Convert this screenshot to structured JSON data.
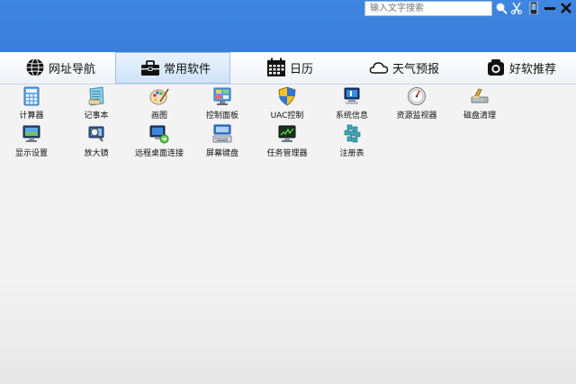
{
  "search": {
    "placeholder": "输入文字搜索"
  },
  "toolbar_icons": [
    "search-icon",
    "scissors-icon",
    "phone-icon",
    "minimize-icon",
    "close-icon"
  ],
  "tabs": [
    {
      "label": "网址导航",
      "icon": "globe-icon",
      "active": false
    },
    {
      "label": "常用软件",
      "icon": "toolbox-icon",
      "active": true
    },
    {
      "label": "日历",
      "icon": "calendar-icon",
      "active": false
    },
    {
      "label": "天气预报",
      "icon": "cloud-icon",
      "active": false
    },
    {
      "label": "好软推荐",
      "icon": "camera-icon",
      "active": false
    }
  ],
  "apps": [
    {
      "label": "计算器",
      "icon": "calculator-icon"
    },
    {
      "label": "记事本",
      "icon": "notepad-icon"
    },
    {
      "label": "画图",
      "icon": "paint-icon"
    },
    {
      "label": "控制面板",
      "icon": "control-panel-icon"
    },
    {
      "label": "UAC控制",
      "icon": "uac-shield-icon"
    },
    {
      "label": "系统信息",
      "icon": "system-info-icon"
    },
    {
      "label": "资源监视器",
      "icon": "resource-monitor-icon"
    },
    {
      "label": "磁盘清理",
      "icon": "disk-cleanup-icon"
    },
    {
      "label": "显示设置",
      "icon": "display-settings-icon"
    },
    {
      "label": "放大镜",
      "icon": "magnifier-icon"
    },
    {
      "label": "远程桌面连接",
      "icon": "remote-desktop-icon"
    },
    {
      "label": "屏幕键盘",
      "icon": "on-screen-keyboard-icon"
    },
    {
      "label": "任务管理器",
      "icon": "task-manager-icon"
    },
    {
      "label": "注册表",
      "icon": "registry-icon"
    }
  ]
}
